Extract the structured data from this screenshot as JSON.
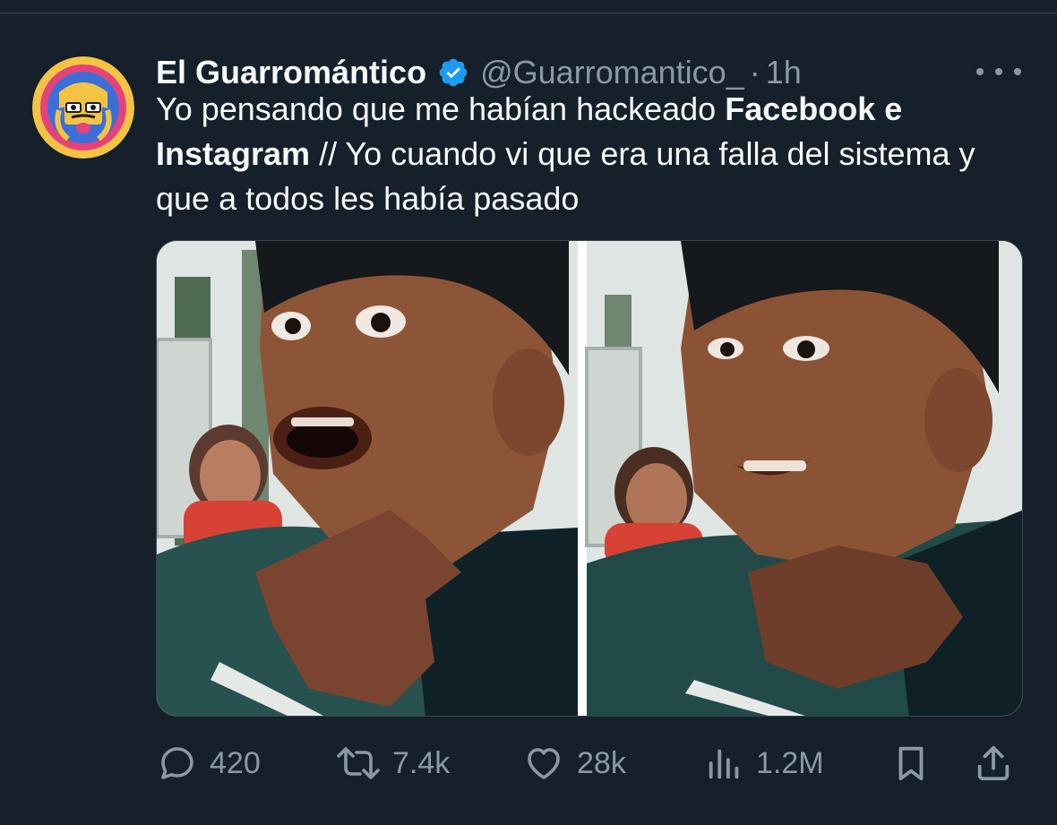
{
  "tweet": {
    "author": {
      "display_name": "El Guarromántico",
      "handle": "@Guarromantico_",
      "verified": true,
      "avatar_icon": "illustrated-face-avatar"
    },
    "separator": "·",
    "time": "1h",
    "text_parts": [
      "Yo pensando que me habían hackeado ",
      "Facebook e Instagram",
      " // Yo cuando vi que era una falla del sistema y que a todos les había pasado"
    ],
    "media": {
      "icon": "two-panel-meme-photo"
    },
    "actions": {
      "reply": {
        "icon": "reply-icon",
        "count": "420"
      },
      "retweet": {
        "icon": "retweet-icon",
        "count": "7.4k"
      },
      "like": {
        "icon": "heart-icon",
        "count": "28k"
      },
      "views": {
        "icon": "views-chart-icon",
        "count": "1.2M"
      },
      "bookmark": {
        "icon": "bookmark-icon"
      },
      "share": {
        "icon": "share-icon"
      }
    }
  },
  "colors": {
    "background": "#15202b",
    "text": "#f7f9f9",
    "secondary": "#8b98a5",
    "verified_blue": "#1d9bf0",
    "border": "#38444d"
  }
}
